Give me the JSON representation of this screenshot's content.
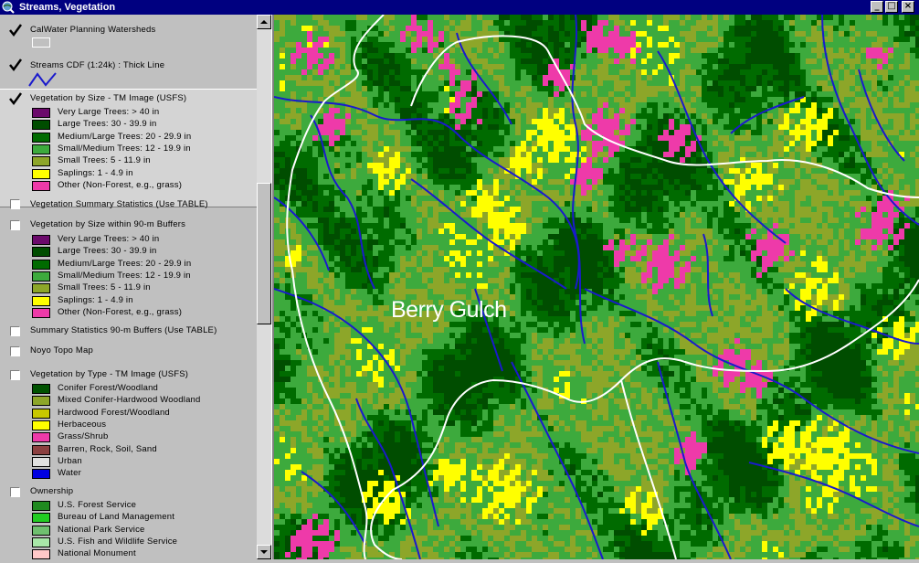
{
  "window": {
    "title": "Streams, Vegetation",
    "minimize_icon": "minimize-icon",
    "maximize_icon": "maximize-icon",
    "close_icon": "close-icon"
  },
  "legend": {
    "themes": [
      {
        "name": "CalWater Planning Watersheds",
        "checked": true,
        "symbol": "hollow-rectangle"
      },
      {
        "name": "Streams CDF (1:24k) : Thick Line",
        "checked": true,
        "symbol": "blue-line"
      },
      {
        "name": "Vegetation by Size - TM Image (USFS)",
        "checked": true,
        "classes": [
          {
            "label": "Very Large Trees: > 40  in",
            "color": "#6b0a6b"
          },
          {
            "label": "Large Trees: 30 - 39.9 in",
            "color": "#004d00"
          },
          {
            "label": "Medium/Large Trees: 20 - 29.9 in",
            "color": "#006b00"
          },
          {
            "label": "Small/Medium Trees: 12 - 19.9 in",
            "color": "#3daa3d"
          },
          {
            "label": "Small Trees: 5 - 11.9 in",
            "color": "#8da629"
          },
          {
            "label": "Saplings: 1 - 4.9 in",
            "color": "#ffff00"
          },
          {
            "label": "Other (Non-Forest, e.g., grass)",
            "color": "#ee3aa9"
          }
        ]
      },
      {
        "name": "Vegetation Summary Statistics (Use TABLE)",
        "checked": false
      },
      {
        "name": "Vegetation by Size within 90-m Buffers",
        "checked": false,
        "classes": [
          {
            "label": "Very Large Trees: > 40  in",
            "color": "#6b0a6b"
          },
          {
            "label": "Large Trees: 30 - 39.9 in",
            "color": "#004d00"
          },
          {
            "label": "Medium/Large Trees: 20 - 29.9 in",
            "color": "#006b00"
          },
          {
            "label": "Small/Medium Trees: 12 - 19.9 in",
            "color": "#3daa3d"
          },
          {
            "label": "Small Trees: 5 - 11.9 in",
            "color": "#8da629"
          },
          {
            "label": "Saplings: 1 - 4.9 in",
            "color": "#ffff00"
          },
          {
            "label": "Other (Non-Forest, e.g., grass)",
            "color": "#ee3aa9"
          }
        ]
      },
      {
        "name": "Summary Statistics 90-m Buffers (Use TABLE)",
        "checked": false
      },
      {
        "name": "Noyo Topo Map",
        "checked": false
      },
      {
        "name": "Vegetation by Type - TM Image (USFS)",
        "checked": false,
        "classes": [
          {
            "label": "Conifer Forest/Woodland",
            "color": "#005200"
          },
          {
            "label": "Mixed Conifer-Hardwood Woodland",
            "color": "#8da629"
          },
          {
            "label": "Hardwood Forest/Woodland",
            "color": "#c8c800"
          },
          {
            "label": "Herbaceous",
            "color": "#ffff00"
          },
          {
            "label": "Grass/Shrub",
            "color": "#ee3aa9"
          },
          {
            "label": "Barren, Rock, Soil, Sand",
            "color": "#8b4040"
          },
          {
            "label": "Urban",
            "color": "#e0e0e0"
          },
          {
            "label": "Water",
            "color": "#0000e0"
          }
        ]
      },
      {
        "name": "Ownership",
        "checked": false,
        "classes": [
          {
            "label": "U.S. Forest Service",
            "color": "#1f8a1f"
          },
          {
            "label": "Bureau of Land Management",
            "color": "#22cc22"
          },
          {
            "label": "National Park Service",
            "color": "#6fc06f"
          },
          {
            "label": "U.S. Fish and Wildlife Service",
            "color": "#a8e8a8"
          },
          {
            "label": "National Monument",
            "color": "#ffc8c8"
          }
        ]
      }
    ]
  },
  "map": {
    "place_label": "Berry Gulch",
    "colors": {
      "conifer_dark": "#004d00",
      "medium_large": "#006b00",
      "small_medium": "#3daa3d",
      "small": "#8da629",
      "saplings": "#ffff00",
      "other": "#ee3aa9",
      "stream": "#1a1acc",
      "watershed": "#ffffff"
    }
  }
}
